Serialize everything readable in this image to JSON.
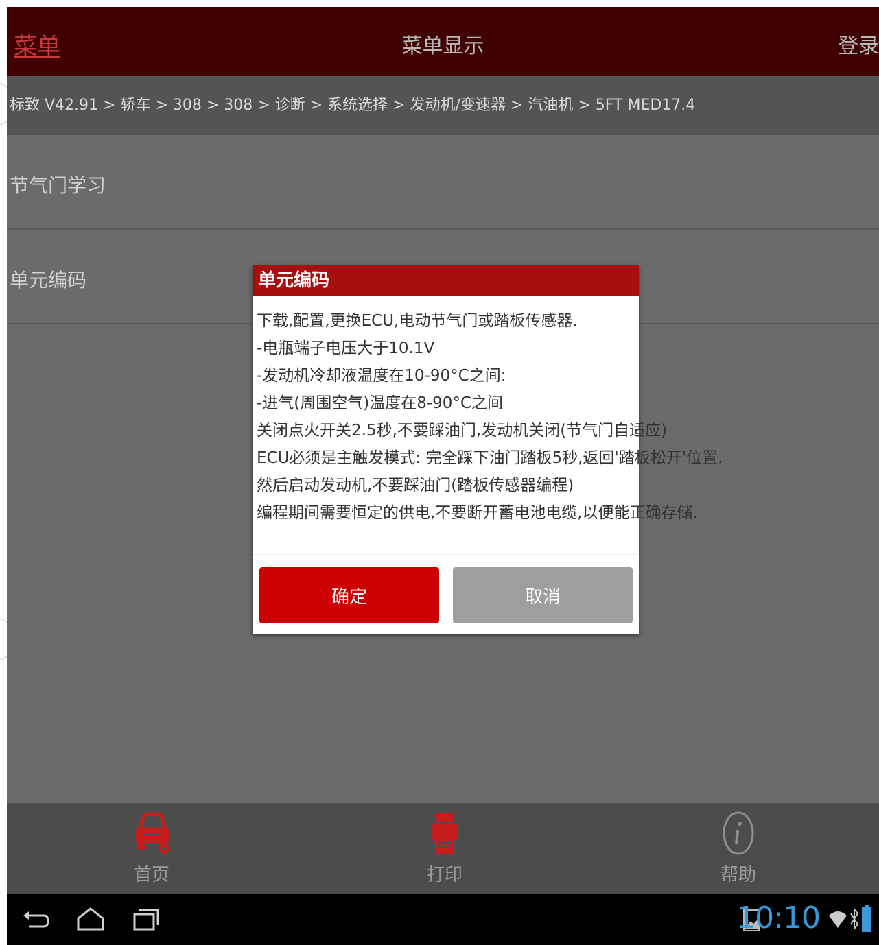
{
  "header": {
    "menu_label": "菜单",
    "title": "菜单显示",
    "login_label": "登录"
  },
  "breadcrumb": "标致 V42.91 > 轿车 > 308 > 308 > 诊断 > 系统选择 > 发动机/变速器 > 汽油机 > 5FT MED17.4",
  "menu_items": [
    {
      "label": "节气门学习"
    },
    {
      "label": "单元编码"
    }
  ],
  "dialog": {
    "title": "单元编码",
    "lines": [
      "下载,配置,更换ECU,电动节气门或踏板传感器.",
      " -电瓶端子电压大于10.1V",
      " -发动机冷却液温度在10-90°C之间:",
      " -进气(周围空气)温度在8-90°C之间",
      " 关闭点火开关2.5秒,不要踩油门,发动机关闭(节气门自适应)",
      " ECU必须是主触发模式: 完全踩下油门踏板5秒,返回'踏板松开'位置,",
      "然后启动发动机,不要踩油门(踏板传感器编程)",
      " 编程期间需要恒定的供电,不要断开蓄电池电缆,以便能正确存储."
    ],
    "confirm_label": "确定",
    "cancel_label": "取消"
  },
  "bottom_nav": [
    {
      "label": "首页",
      "icon": "car-diagnostic-icon"
    },
    {
      "label": "打印",
      "icon": "printer-icon"
    },
    {
      "label": "帮助",
      "icon": "info-icon"
    }
  ],
  "system_bar": {
    "clock": "10:10",
    "status_icons": [
      "gallery-icon",
      "wifi-icon",
      "bluetooth-icon",
      "battery-icon"
    ]
  },
  "colors": {
    "header_bg": "#3f0101",
    "accent_red": "#cc0000",
    "dialog_header": "#a50f0f",
    "clock_blue": "#3a9ad9"
  }
}
